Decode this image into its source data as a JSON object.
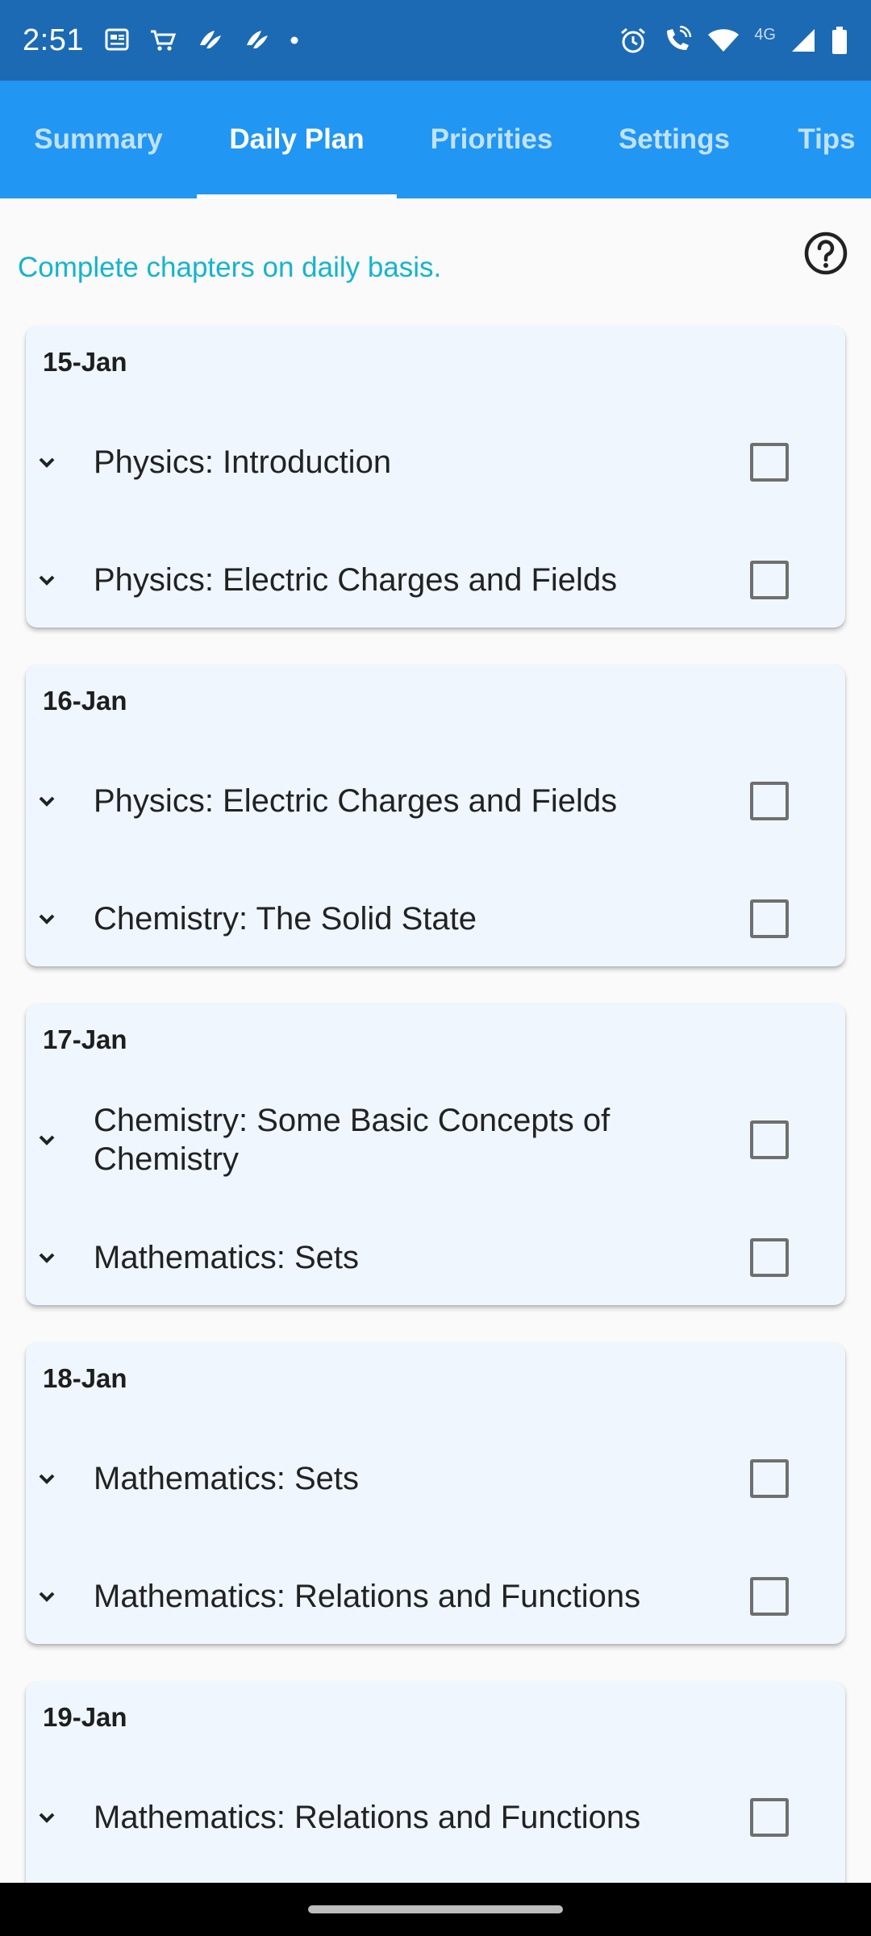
{
  "status_bar": {
    "time": "2:51",
    "network_label": "4G",
    "left_icons": [
      "news-icon",
      "cart-icon",
      "app-icon",
      "app-icon",
      "dot-icon"
    ],
    "right_icons": [
      "alarm-icon",
      "wifi-call-icon",
      "wifi-icon",
      "signal-icon",
      "battery-icon"
    ]
  },
  "tabs": [
    {
      "label": "Summary",
      "active": false
    },
    {
      "label": "Daily Plan",
      "active": true
    },
    {
      "label": "Priorities",
      "active": false
    },
    {
      "label": "Settings",
      "active": false
    },
    {
      "label": "Tips",
      "active": false
    }
  ],
  "intro": {
    "text": "Complete chapters on daily basis.",
    "help_icon": "help-circle-icon"
  },
  "colors": {
    "status_bar": "#1c6ab3",
    "app_bar": "#2196f3",
    "intro_text": "#14b4cf",
    "card_bg": "#eff6fd"
  },
  "days": [
    {
      "date": "15-Jan",
      "items": [
        {
          "label": "Physics: Introduction",
          "checked": false
        },
        {
          "label": "Physics: Electric Charges and Fields",
          "checked": false
        }
      ]
    },
    {
      "date": "16-Jan",
      "items": [
        {
          "label": "Physics: Electric Charges and Fields",
          "checked": false
        },
        {
          "label": "Chemistry: The Solid State",
          "checked": false
        }
      ]
    },
    {
      "date": "17-Jan",
      "items": [
        {
          "label": "Chemistry: Some Basic Concepts of Chemistry",
          "checked": false
        },
        {
          "label": "Mathematics: Sets",
          "checked": false
        }
      ]
    },
    {
      "date": "18-Jan",
      "items": [
        {
          "label": "Mathematics: Sets",
          "checked": false
        },
        {
          "label": "Mathematics: Relations and Functions",
          "checked": false
        }
      ]
    },
    {
      "date": "19-Jan",
      "items": [
        {
          "label": "Mathematics: Relations and Functions",
          "checked": false
        }
      ]
    }
  ]
}
